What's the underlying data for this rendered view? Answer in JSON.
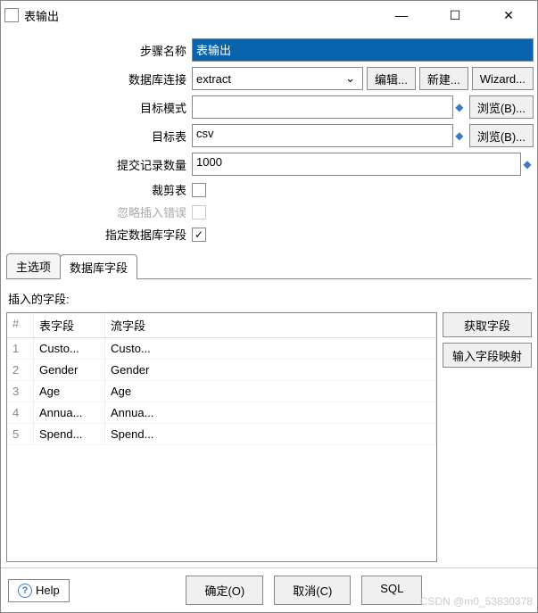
{
  "window": {
    "title": "表输出"
  },
  "form": {
    "step_name_label": "步骤名称",
    "step_name_value": "表输出",
    "db_conn_label": "数据库连接",
    "db_conn_value": "extract",
    "edit_btn": "编辑...",
    "new_btn": "新建...",
    "wizard_btn": "Wizard...",
    "target_schema_label": "目标模式",
    "target_schema_value": "",
    "browse_btn": "浏览(B)...",
    "target_table_label": "目标表",
    "target_table_value": "csv",
    "commit_size_label": "提交记录数量",
    "commit_size_value": "1000",
    "truncate_label": "裁剪表",
    "truncate_checked": false,
    "ignore_ins_err_label": "忽略插入错误",
    "specify_fields_label": "指定数据库字段",
    "specify_fields_checked": true
  },
  "tabs": {
    "main_tab": "主选项",
    "db_fields_tab": "数据库字段",
    "active": "db_fields_tab"
  },
  "fields_section": {
    "label": "插入的字段:",
    "col_num": "#",
    "col_table_field": "表字段",
    "col_stream_field": "流字段",
    "rows": [
      {
        "n": "1",
        "tf": "Custo...",
        "sf": "Custo..."
      },
      {
        "n": "2",
        "tf": "Gender",
        "sf": "Gender"
      },
      {
        "n": "3",
        "tf": "Age",
        "sf": "Age"
      },
      {
        "n": "4",
        "tf": "Annua...",
        "sf": "Annua..."
      },
      {
        "n": "5",
        "tf": "Spend...",
        "sf": "Spend..."
      }
    ],
    "get_fields_btn": "获取字段",
    "map_fields_btn": "输入字段映射"
  },
  "footer": {
    "help": "Help",
    "ok": "确定(O)",
    "cancel": "取消(C)",
    "sql": "SQL"
  },
  "watermark": "CSDN @m0_53830378"
}
